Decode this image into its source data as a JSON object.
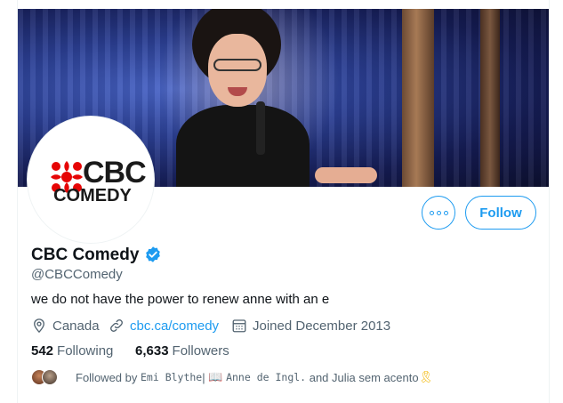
{
  "profile": {
    "display_name": "CBC Comedy",
    "handle": "@CBCComedy",
    "bio": "we do not have the power to renew anne with an e",
    "avatar_logo_top": "CBC",
    "avatar_logo_bottom": "COMEDY",
    "verified_icon": "verified-badge-icon"
  },
  "actions": {
    "more_icon": "more-options-icon",
    "follow_label": "Follow"
  },
  "meta": {
    "location": "Canada",
    "url": "cbc.ca/comedy",
    "joined": "Joined December 2013"
  },
  "counts": {
    "following_value": "542",
    "following_label": "Following",
    "followers_value": "6,633",
    "followers_label": "Followers"
  },
  "followed_by": {
    "prefix": "Followed by",
    "name1": "Emi Blythe",
    "separator": " | ",
    "name2_emoji": "📖",
    "name2": "Anne de Ingl.",
    "suffix": "and Julia sem acento",
    "ribbon_emoji": "🎗"
  },
  "colors": {
    "accent": "#1d9bf0",
    "secondary_text": "#536471",
    "cbc_red": "#e60505"
  }
}
